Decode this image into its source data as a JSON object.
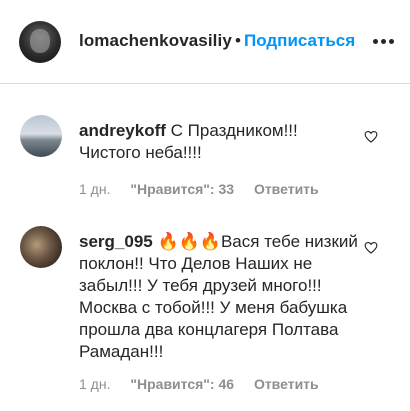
{
  "header": {
    "username": "lomachenkovasiliy",
    "separator": "•",
    "follow_label": "Подписаться"
  },
  "comments": [
    {
      "username": "andreykoff",
      "text": "С Праздником!!! Чистого неба!!!!",
      "time": "1 дн.",
      "likes": "\"Нравится\": 33",
      "reply_label": "Ответить"
    },
    {
      "username": "serg_095",
      "text": "🔥🔥🔥Вася тебе низкий поклон!! Что Делов Наших не забыл!!! У тебя друзей много!!! Москва с тобой!!! У меня бабушка прошла два концлагеря Полтава Рамадан!!!",
      "time": "1 дн.",
      "likes": "\"Нравится\": 46",
      "reply_label": "Ответить"
    }
  ],
  "colors": {
    "accent": "#0095f6",
    "text": "#262626",
    "secondary": "#8e8e8e",
    "divider": "#dbdbdb"
  },
  "icons": [
    "more-icon",
    "heart-icon"
  ]
}
